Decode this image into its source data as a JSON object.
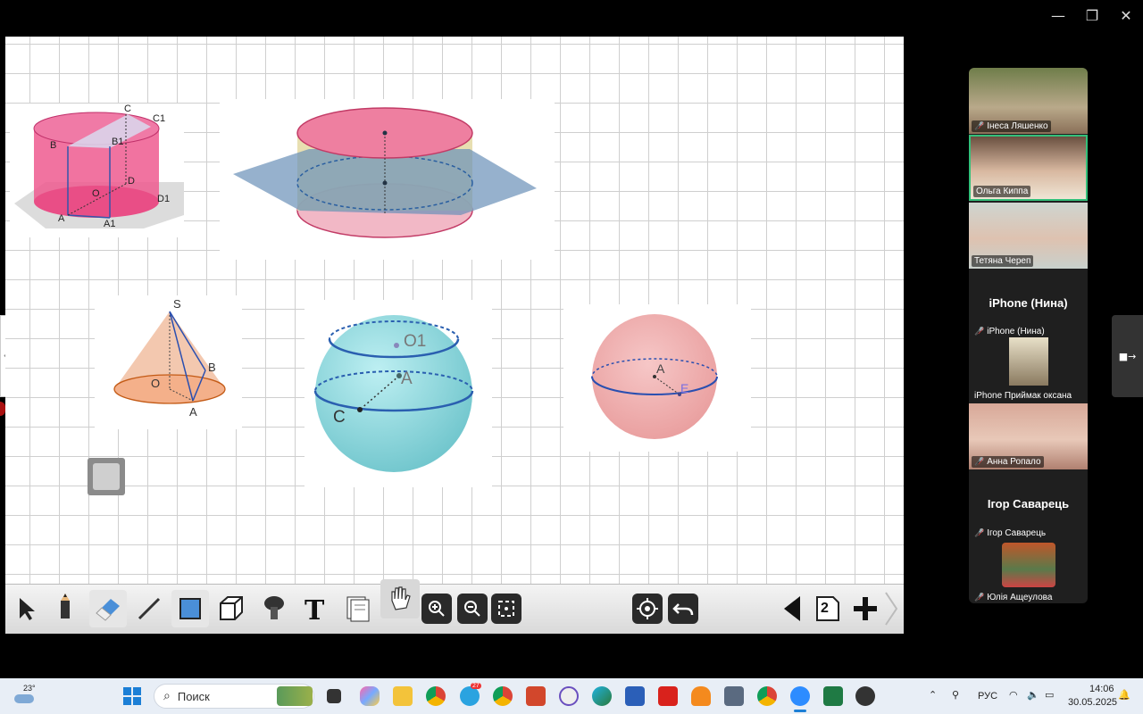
{
  "window": {
    "minimize": "—",
    "restore": "❐",
    "close": "✕"
  },
  "figures": {
    "cylinder1": {
      "labels": [
        "C",
        "C1",
        "B",
        "B1",
        "O",
        "D",
        "D1",
        "A",
        "A1"
      ]
    },
    "cylinder2": {
      "labels": []
    },
    "cone": {
      "labels": [
        "S",
        "B",
        "O",
        "A"
      ]
    },
    "sphere1": {
      "labels": [
        "O1",
        "A",
        "C"
      ]
    },
    "sphere2": {
      "labels": [
        "A",
        "E"
      ]
    }
  },
  "toolbar": {
    "tools": [
      "select",
      "pencil",
      "eraser",
      "line",
      "rectangle",
      "cube",
      "fill",
      "text",
      "pages",
      "hand",
      "zoom-in",
      "zoom-out",
      "fit",
      "locate",
      "undo",
      "prev",
      "page",
      "add",
      "next"
    ],
    "page_number": "2"
  },
  "participants": [
    {
      "name": "Інеса Ляшенко",
      "muted": true,
      "type": "video"
    },
    {
      "name": "Ольга Киппа",
      "muted": false,
      "type": "video",
      "active": true
    },
    {
      "name": "Тетяна Череп",
      "muted": false,
      "type": "video"
    },
    {
      "name": "iPhone (Нина)",
      "muted": true,
      "type": "name",
      "big": "iPhone (Нина)"
    },
    {
      "name": "iPhone Приймак оксана",
      "muted": false,
      "type": "avatar"
    },
    {
      "name": "Анна Ропало",
      "muted": true,
      "type": "video"
    },
    {
      "name": "Ігор Саварець",
      "muted": true,
      "type": "name",
      "big": "Ігор Саварець"
    },
    {
      "name": "Юлія Ащеулова",
      "muted": true,
      "type": "avatar"
    }
  ],
  "taskbar": {
    "weather": "23°",
    "search_placeholder": "Поиск",
    "lang": "РУС",
    "time": "14:06",
    "date": "30.05.2025",
    "telegram_badge": "27"
  },
  "colors": {
    "active_border": "#33c07a",
    "board_grid": "#cfcfcf"
  }
}
